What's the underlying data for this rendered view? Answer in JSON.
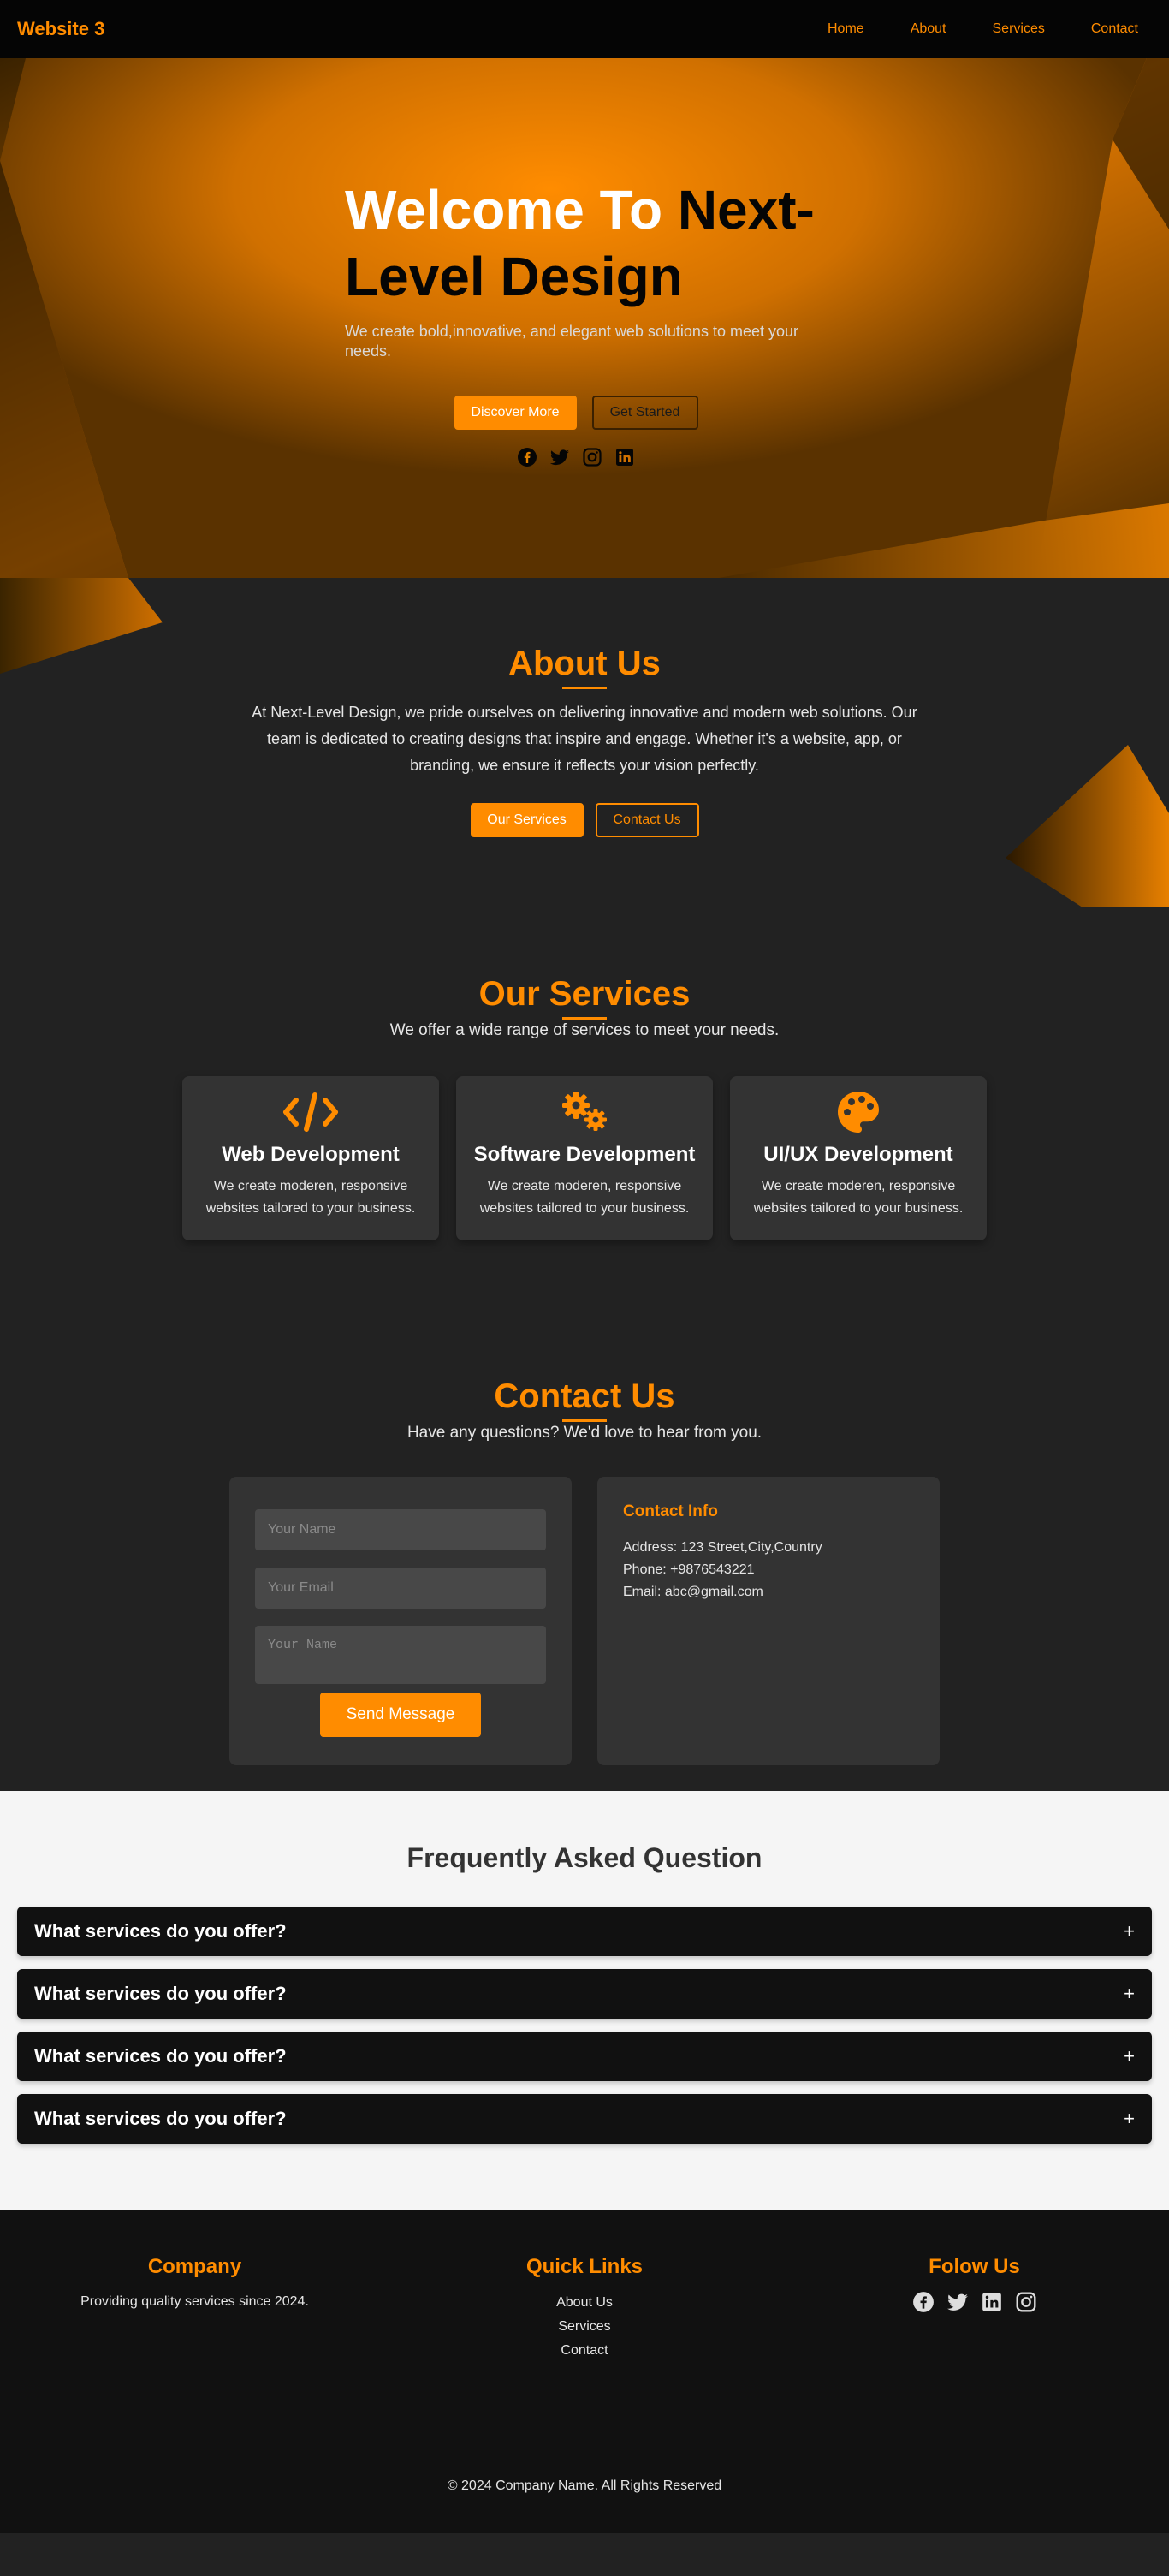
{
  "colors": {
    "accent": "#ff8c00",
    "dark": "#222222",
    "nav": "#050505",
    "card": "#333333",
    "light": "#f5f5f5"
  },
  "nav": {
    "brand": "Website 3",
    "links": [
      "Home",
      "About",
      "Services",
      "Contact"
    ]
  },
  "hero": {
    "title_white": "Welcome To ",
    "title_black": "Next-",
    "title_line2": "Level Design",
    "subtitle": "We create bold,innovative, and elegant web solutions to meet your needs.",
    "primary_button": "Discover More",
    "secondary_button": "Get Started",
    "social_icons": [
      "facebook-icon",
      "twitter-icon",
      "instagram-icon",
      "linkedin-icon"
    ]
  },
  "about": {
    "title": "About Us",
    "text": "At Next-Level Design, we pride ourselves on delivering innovative and modern web solutions. Our team is dedicated to creating designs that inspire and engage. Whether it's a website, app, or branding, we ensure it reflects your vision perfectly.",
    "primary_button": "Our Services",
    "secondary_button": "Contact Us"
  },
  "services": {
    "title": "Our Services",
    "subtitle": "We offer a wide range of services to meet your needs.",
    "cards": [
      {
        "icon": "code-icon",
        "title": "Web Development",
        "desc": "We create moderen, responsive websites tailored to your business."
      },
      {
        "icon": "gears-icon",
        "title": "Software Development",
        "desc": "We create moderen, responsive websites tailored to your business."
      },
      {
        "icon": "palette-icon",
        "title": "UI/UX Development",
        "desc": "We create moderen, responsive websites tailored to your business."
      }
    ]
  },
  "contact": {
    "title": "Contact Us",
    "subtitle": "Have any questions? We'd love to hear from you.",
    "name_placeholder": "Your Name",
    "email_placeholder": "Your Email",
    "message_placeholder": "Your Name",
    "send_button": "Send Message",
    "info_title": "Contact Info",
    "address": "Address: 123 Street,City,Country",
    "phone": "Phone: +9876543221",
    "email": "Email: abc@gmail.com"
  },
  "faq": {
    "title": "Frequently Asked Question",
    "items": [
      {
        "q": "What services do you offer?",
        "toggle": "+"
      },
      {
        "q": "What services do you offer?",
        "toggle": "+"
      },
      {
        "q": "What services do you offer?",
        "toggle": "+"
      },
      {
        "q": "What services do you offer?",
        "toggle": "+"
      }
    ]
  },
  "footer": {
    "company_title": "Company",
    "company_text": "Providing quality services since 2024.",
    "links_title": "Quick Links",
    "links": [
      "About Us",
      "Services",
      "Contact"
    ],
    "follow_title": "Folow Us",
    "social_icons": [
      "facebook-icon",
      "twitter-icon",
      "linkedin-icon",
      "instagram-icon"
    ],
    "copyright": "© 2024 Company Name. All Rights Reserved"
  }
}
